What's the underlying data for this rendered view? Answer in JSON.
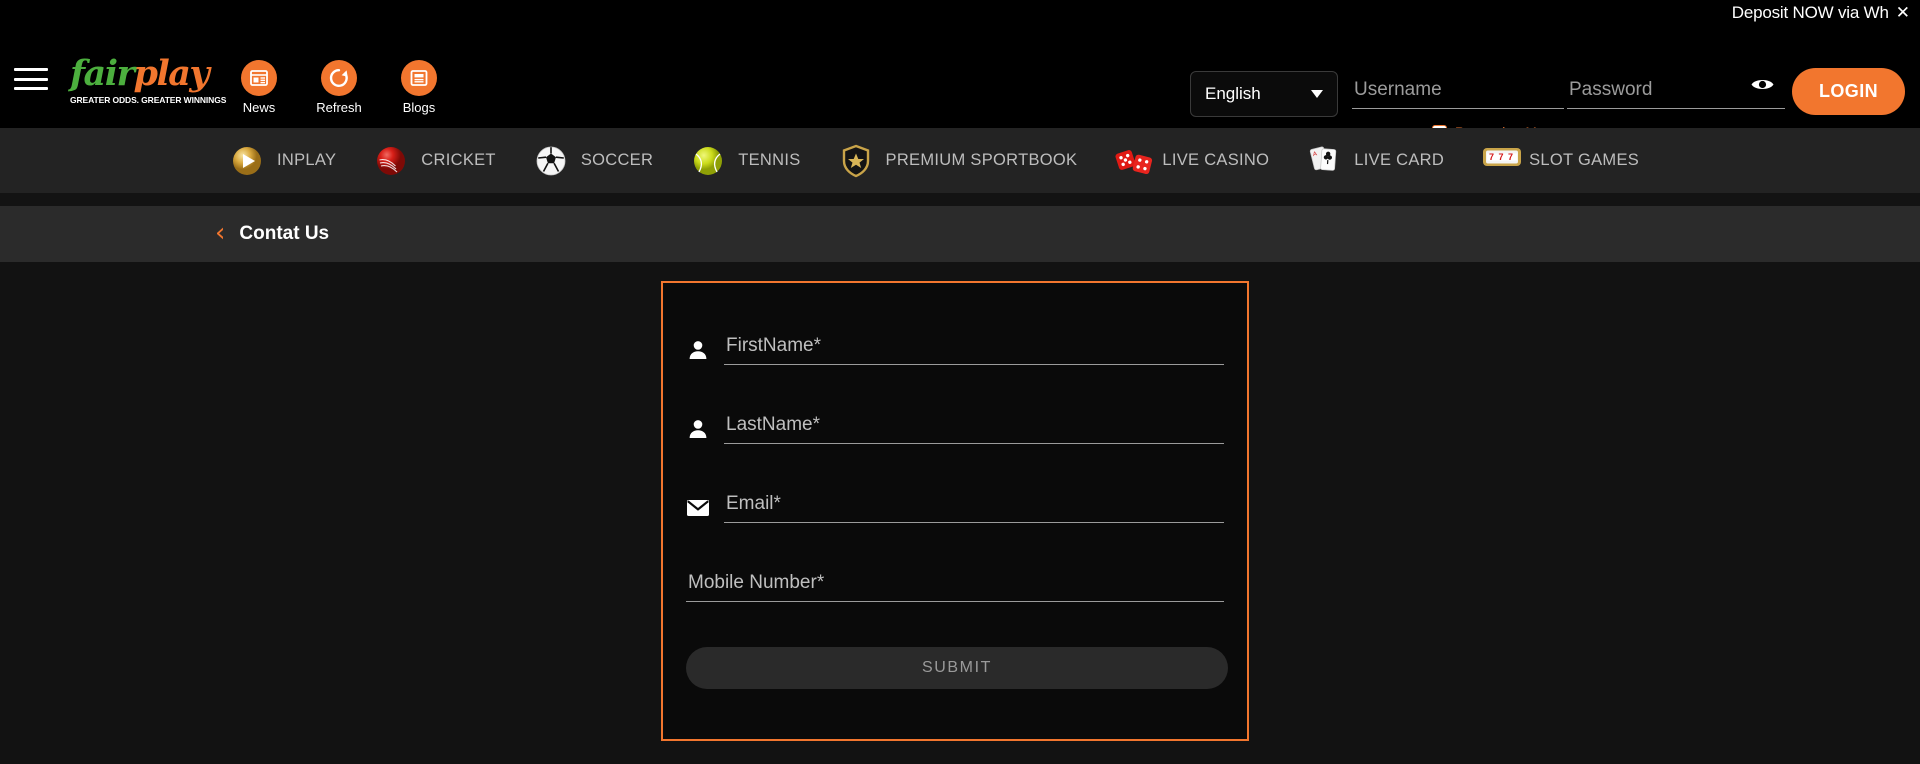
{
  "promo": {
    "text": "Deposit NOW via Wh",
    "close_icon": "close-icon"
  },
  "header": {
    "menu_icon": "hamburger-menu-icon",
    "brand": {
      "name_part1": "fair",
      "name_part2": "play",
      "tagline": "GREATER ODDS. GREATER WINNINGS"
    },
    "quick_links": [
      {
        "label": "News",
        "icon": "news-icon"
      },
      {
        "label": "Refresh",
        "icon": "refresh-icon"
      },
      {
        "label": "Blogs",
        "icon": "blogs-icon"
      }
    ],
    "language": {
      "selected": "English",
      "caret_icon": "chevron-down-icon"
    },
    "username": {
      "placeholder": "Username",
      "value": ""
    },
    "password": {
      "placeholder": "Password",
      "value": ""
    },
    "password_visibility_icon": "eye-icon",
    "remember_me_label": "Remember Me",
    "login_label": "LOGIN"
  },
  "sports_nav": [
    {
      "label": "INPLAY",
      "icon": "inplay-icon"
    },
    {
      "label": "CRICKET",
      "icon": "cricket-ball-icon"
    },
    {
      "label": "SOCCER",
      "icon": "soccer-ball-icon"
    },
    {
      "label": "TENNIS",
      "icon": "tennis-ball-icon"
    },
    {
      "label": "PREMIUM SPORTBOOK",
      "icon": "shield-star-icon"
    },
    {
      "label": "LIVE CASINO",
      "icon": "dice-icon"
    },
    {
      "label": "LIVE CARD",
      "icon": "playing-cards-icon"
    },
    {
      "label": "SLOT GAMES",
      "icon": "slot-machine-icon"
    }
  ],
  "breadcrumb": {
    "back_icon": "chevron-left-icon",
    "title": "Contat Us"
  },
  "contact_form": {
    "fields": [
      {
        "placeholder": "FirstName*",
        "value": "",
        "icon": "person-icon"
      },
      {
        "placeholder": "LastName*",
        "value": "",
        "icon": "person-icon"
      },
      {
        "placeholder": "Email*",
        "value": "",
        "icon": "envelope-icon"
      },
      {
        "placeholder": "Mobile Number*",
        "value": "",
        "icon": ""
      }
    ],
    "submit_label": "SUBMIT"
  },
  "colors": {
    "accent": "#F2762E",
    "brand_green": "#4CAF3E",
    "page_bg": "#121212",
    "nav_bg": "#232323",
    "breadcrumb_bg": "#2b2b2b"
  }
}
